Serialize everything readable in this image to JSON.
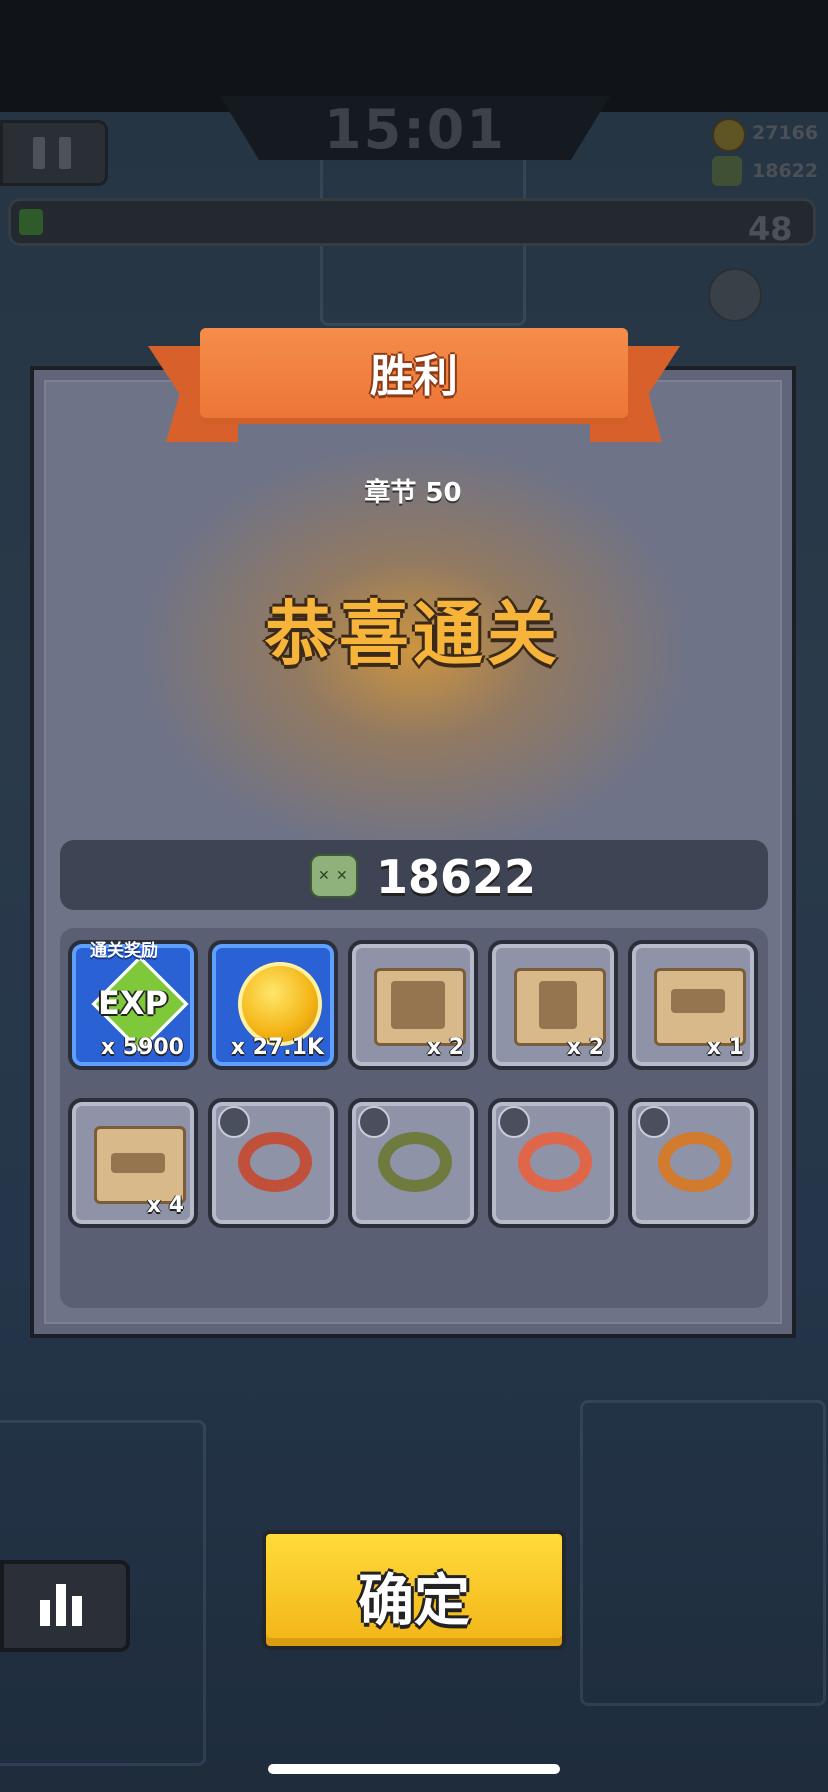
{
  "hud": {
    "timer": "15:01",
    "coins": "27166",
    "kills": "18622",
    "level": "48",
    "xp_progress": 0.03
  },
  "dialog": {
    "title": "胜利",
    "chapter": "章节 50",
    "headline": "恭喜通关",
    "kill_count": "18622",
    "reward_tag": "通关奖励",
    "rewards": [
      {
        "name": "exp",
        "label": "EXP",
        "qty": "x 5900",
        "icon": "exp-icon"
      },
      {
        "name": "gold-coin",
        "qty": "x 27.1K",
        "icon": "coin-icon"
      },
      {
        "name": "armor-scroll",
        "qty": "x 2",
        "icon": "armor-scroll-icon"
      },
      {
        "name": "glove-scroll",
        "qty": "x 2",
        "icon": "glove-scroll-icon"
      },
      {
        "name": "gun-scroll",
        "qty": "x 1",
        "icon": "gun-scroll-icon"
      },
      {
        "name": "belt-scroll",
        "qty": "x 4",
        "icon": "belt-scroll-icon"
      },
      {
        "name": "bone-collar",
        "icon": "bone-collar-icon"
      },
      {
        "name": "tag-collar",
        "icon": "tag-collar-icon"
      },
      {
        "name": "bandage-collar",
        "icon": "bandage-collar-icon"
      },
      {
        "name": "lightning-collar",
        "icon": "lightning-collar-icon"
      }
    ]
  },
  "confirm_label": "确定",
  "colors": {
    "ribbon": "#ec7436",
    "headline": "#f6b43a",
    "confirm": "#f2b418",
    "blue_slot": "#2a62d6"
  }
}
